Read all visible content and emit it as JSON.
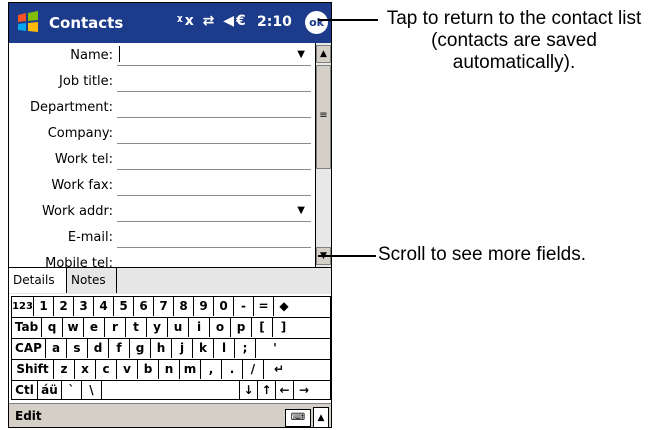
{
  "titlebar": {
    "app_title": "Contacts",
    "status_icons": "ᵡx ⇄ ◀€",
    "time": "2:10",
    "ok_label": "ok",
    "start_icon": "windows-flag-icon"
  },
  "form": {
    "fields": [
      {
        "label": "Name:",
        "has_dropdown": true
      },
      {
        "label": "Job title:"
      },
      {
        "label": "Department:"
      },
      {
        "label": "Company:"
      },
      {
        "label": "Work tel:"
      },
      {
        "label": "Work fax:"
      },
      {
        "label": "Work addr:",
        "has_dropdown": true
      },
      {
        "label": "E-mail:"
      },
      {
        "label": "Mobile tel:"
      }
    ]
  },
  "scrollbar": {
    "up": "▲",
    "thumb": "≡",
    "down": "▼"
  },
  "tabs": [
    {
      "label": "Details",
      "selected": true
    },
    {
      "label": "Notes",
      "selected": false
    }
  ],
  "keyboard": {
    "rows": [
      [
        "123",
        "1",
        "2",
        "3",
        "4",
        "5",
        "6",
        "7",
        "8",
        "9",
        "0",
        "-",
        "=",
        "◆"
      ],
      [
        "Tab",
        "q",
        "w",
        "e",
        "r",
        "t",
        "y",
        "u",
        "i",
        "o",
        "p",
        "[",
        "]"
      ],
      [
        "CAP",
        "a",
        "s",
        "d",
        "f",
        "g",
        "h",
        "j",
        "k",
        "l",
        ";",
        "'"
      ],
      [
        "Shift",
        "z",
        "x",
        "c",
        "v",
        "b",
        "n",
        "m",
        ",",
        ".",
        "/",
        "↵"
      ],
      [
        "Ctl",
        "áü",
        "`",
        "\\",
        "",
        "↓",
        "↑",
        "←",
        "→"
      ]
    ]
  },
  "menubar": {
    "edit_label": "Edit",
    "sip_arrow": "▲"
  },
  "callouts": {
    "ok_text": "Tap to return to the contact list (contacts are saved automatically).",
    "scroll_text": "Scroll to see more fields."
  }
}
